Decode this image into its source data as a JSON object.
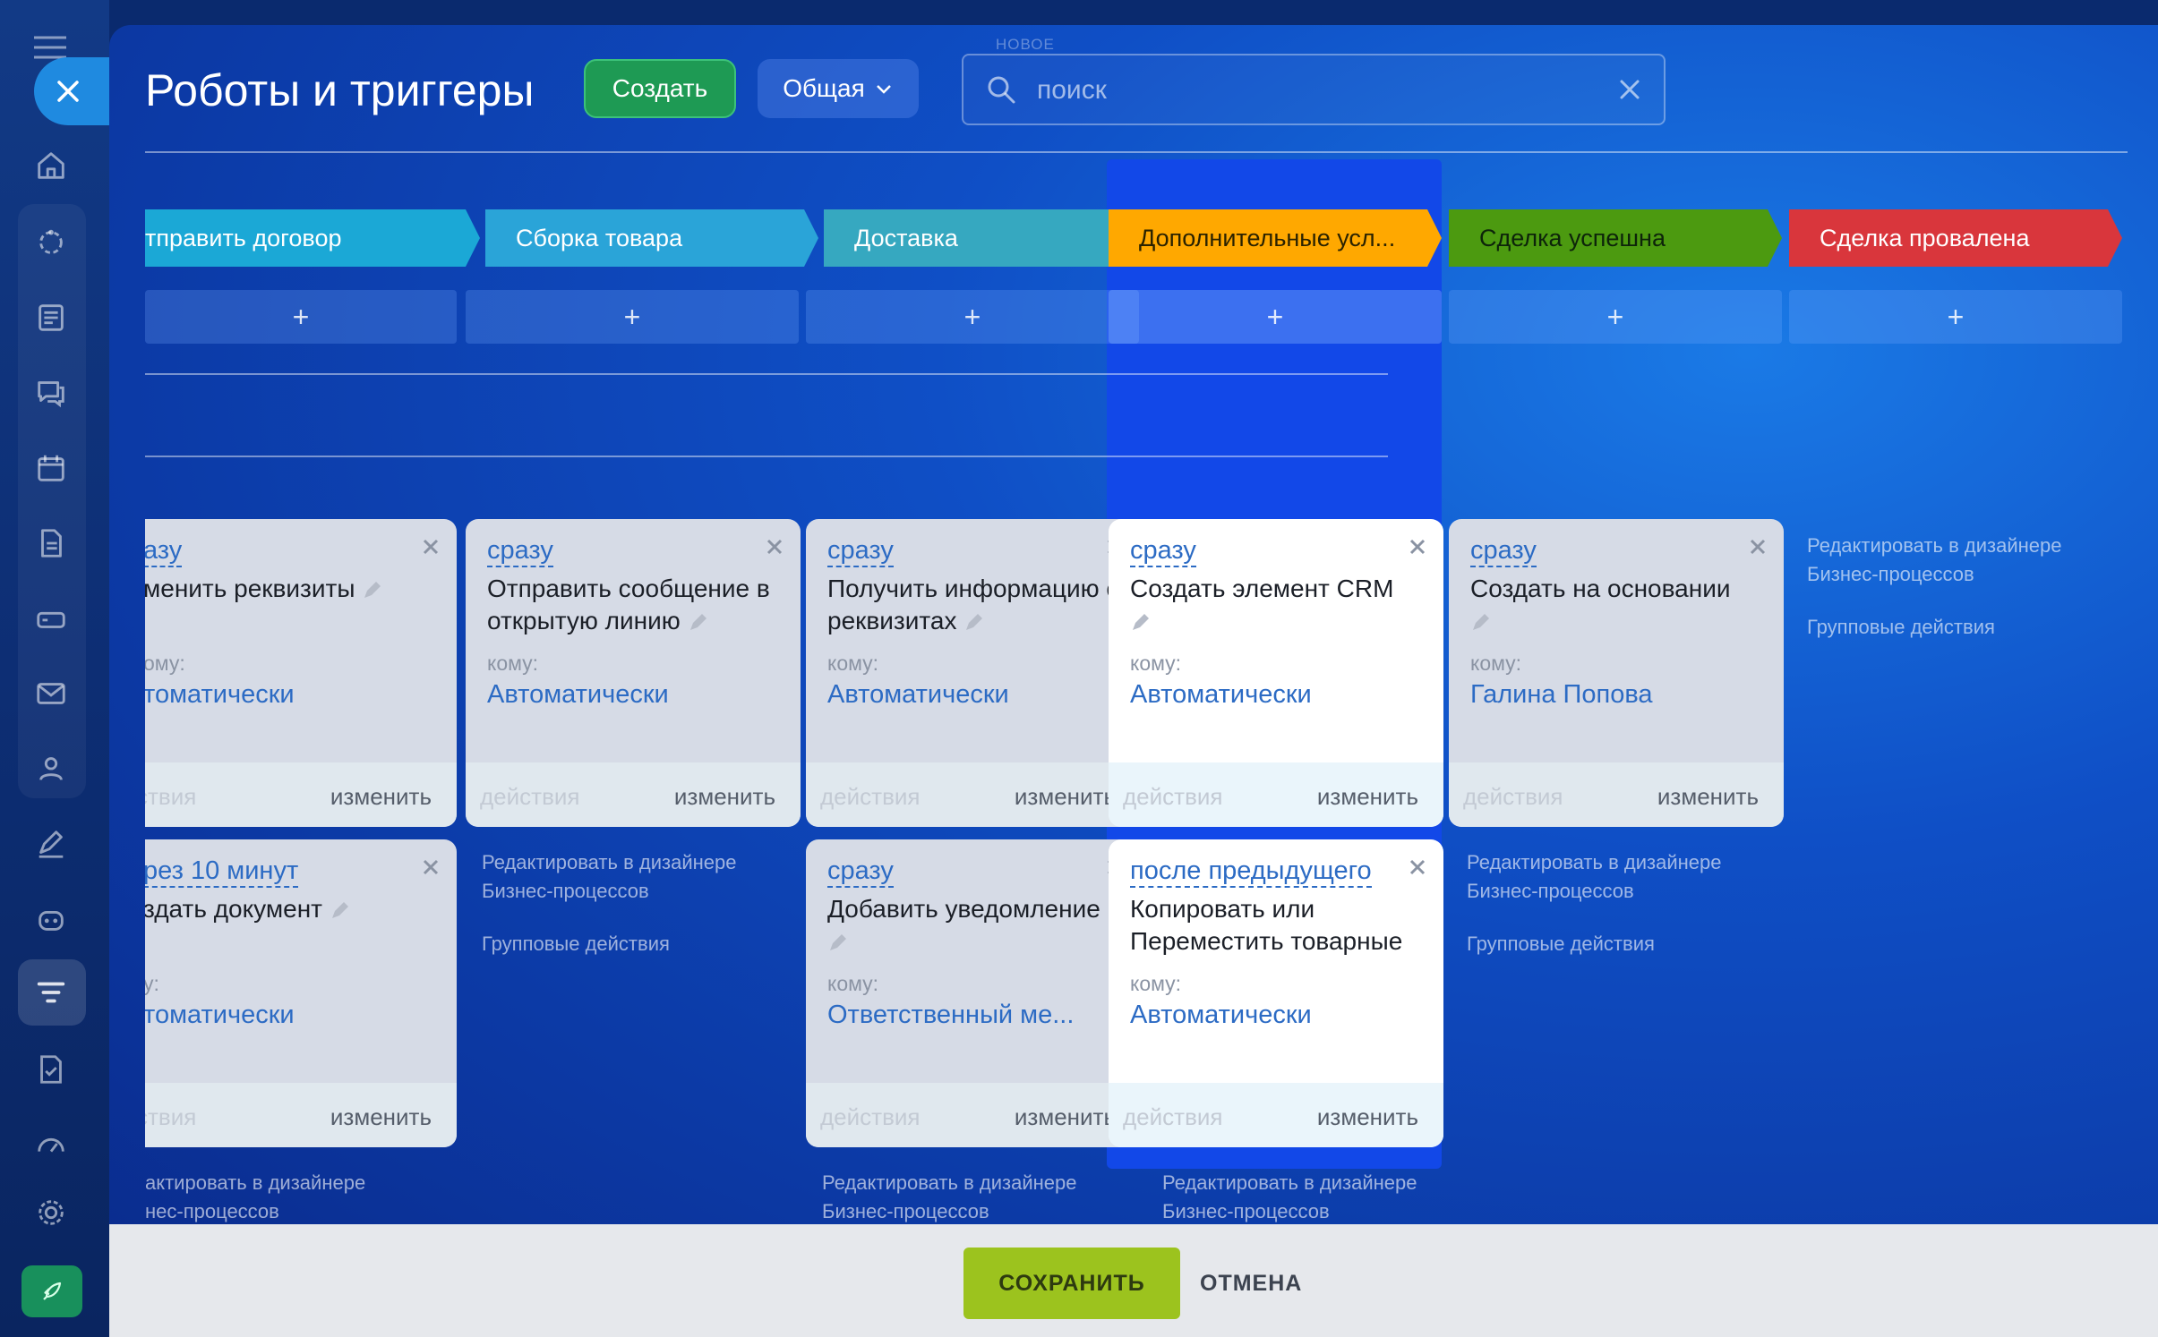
{
  "header": {
    "top_hint": "НОВОЕ",
    "title": "Роботы и триггеры",
    "create_label": "Создать",
    "common_label": "Общая",
    "search_placeholder": "поиск"
  },
  "colors": {
    "stage_1": "#1ba8d6",
    "stage_2": "#2aa4d8",
    "stage_3": "#36a8c0",
    "stage_4": "#ffa800",
    "stage_5": "#4c9a10",
    "stage_6": "#d9363c",
    "accent": "#1248e8"
  },
  "stages": [
    {
      "name": "тправить договор"
    },
    {
      "name": "Сборка товара"
    },
    {
      "name": "Доставка"
    },
    {
      "name": "Дополнительные усл..."
    },
    {
      "name": "Сделка успешна"
    },
    {
      "name": "Сделка провалена"
    }
  ],
  "add_label": "+",
  "labels": {
    "to": "кому:",
    "actions": "действия",
    "edit": "изменить",
    "bp_line1": "Редактировать в дизайнере",
    "bp_line2": "Бизнес-процессов",
    "group": "Групповые действия",
    "bp_partial_line1": "актировать в дизайнере",
    "bp_partial_line2": "нес-процессов"
  },
  "cards": [
    {
      "timing": "азу",
      "title": "менить реквизиты",
      "to": "ому:",
      "resp": "томатически",
      "actions": "ствия"
    },
    {
      "timing": "сразу",
      "title": "Отправить сообщение в открытую линию",
      "resp": "Автоматически"
    },
    {
      "timing": "сразу",
      "title": "Получить информацию о реквизитах",
      "resp": "Автоматически"
    },
    {
      "timing": "сразу",
      "title": "Создать элемент CRM",
      "resp": "Автоматически"
    },
    {
      "timing": "сразу",
      "title": "Создать на основании",
      "resp": "Галина Попова"
    },
    {
      "timing": "рез 10 минут",
      "title": "здать документ",
      "to": "у:",
      "resp": "томатически",
      "actions": "ствия"
    },
    {
      "timing": "сразу",
      "title": "Добавить уведомление",
      "resp": "Ответственный ме..."
    },
    {
      "timing": "после предыдущего",
      "title": "Копировать или Переместить товарные",
      "resp": "Автоматически"
    }
  ],
  "footer": {
    "save_label": "СОХРАНИТЬ",
    "cancel_label": "ОТМЕНА"
  }
}
